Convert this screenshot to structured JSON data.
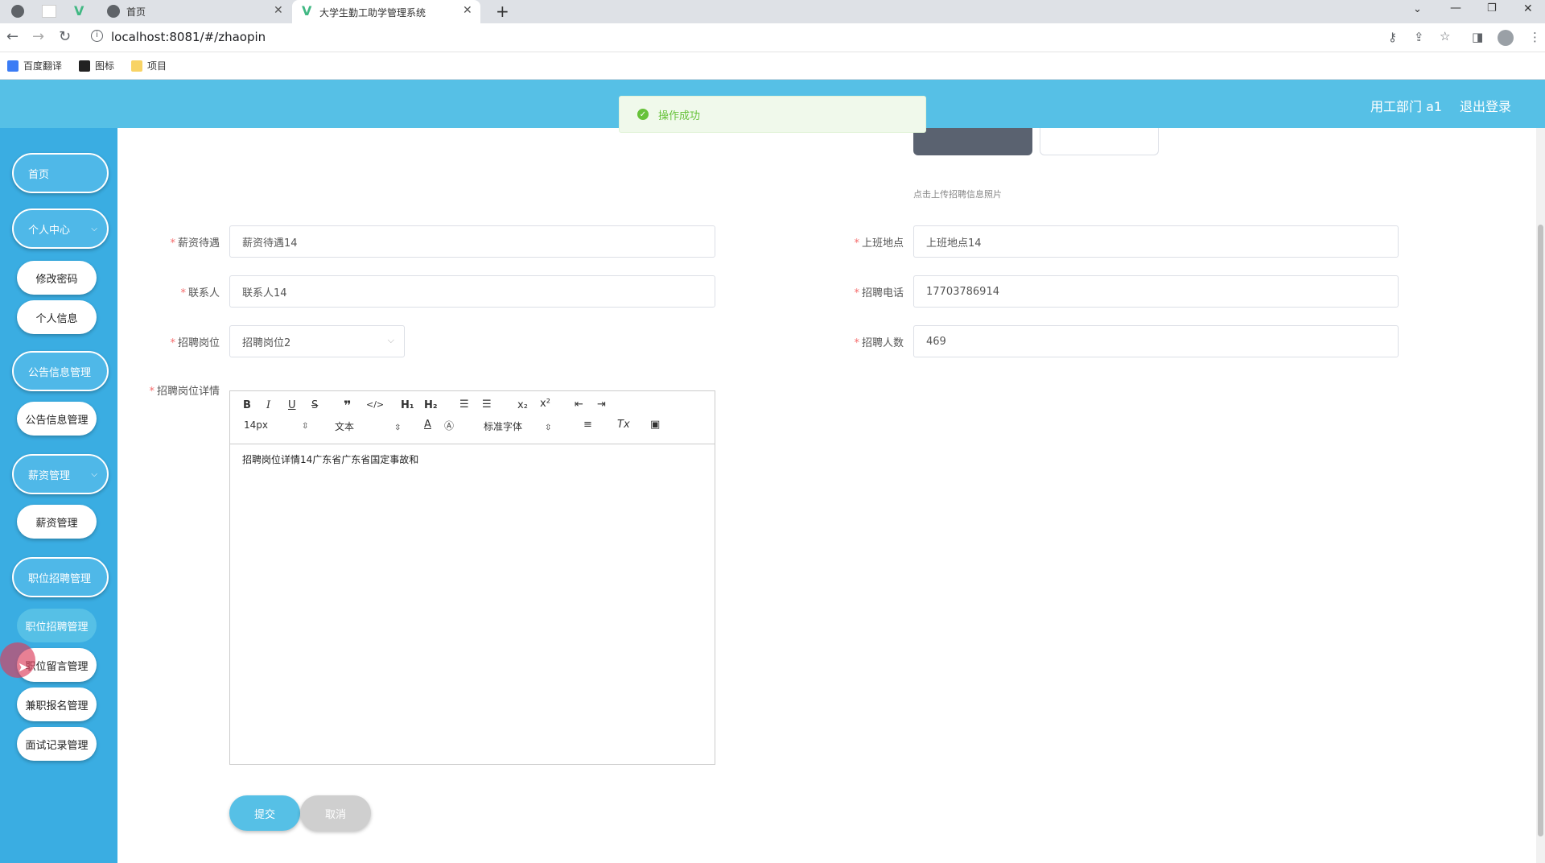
{
  "browser": {
    "tabs": [
      {
        "label": ""
      },
      {
        "label": "首页"
      },
      {
        "label": "大学生勤工助学管理系统"
      }
    ],
    "url": "localhost:8081/#/zhaopin",
    "bookmarks": [
      "百度翻译",
      "图标",
      "项目"
    ]
  },
  "header": {
    "user_label": "用工部门 a1",
    "logout_label": "退出登录"
  },
  "toast": {
    "message": "操作成功"
  },
  "sidebar": {
    "home": "首页",
    "personal_center": "个人中心",
    "change_password": "修改密码",
    "personal_info": "个人信息",
    "notice_group": "公告信息管理",
    "notice_manage": "公告信息管理",
    "salary_group": "薪资管理",
    "salary_manage": "薪资管理",
    "recruit_group": "职位招聘管理",
    "recruit_manage": "职位招聘管理",
    "message_manage": "职位留言管理",
    "apply_manage": "兼职报名管理",
    "interview_manage": "面试记录管理"
  },
  "form": {
    "upload_hint": "点击上传招聘信息照片",
    "salary": {
      "label": "薪资待遇",
      "value": "薪资待遇14"
    },
    "location": {
      "label": "上班地点",
      "value": "上班地点14"
    },
    "contact": {
      "label": "联系人",
      "value": "联系人14"
    },
    "phone": {
      "label": "招聘电话",
      "value": "17703786914"
    },
    "position": {
      "label": "招聘岗位",
      "value": "招聘岗位2"
    },
    "headcount": {
      "label": "招聘人数",
      "value": "469"
    },
    "details": {
      "label": "招聘岗位详情",
      "value": "招聘岗位详情14广东省广东省国定事故和"
    },
    "editor_toolbar": {
      "font_size": "14px",
      "block_type": "文本",
      "font_family": "标准字体"
    },
    "submit_label": "提交",
    "cancel_label": "取消"
  },
  "colors": {
    "header": "#56c0e6",
    "sidebar": "#3aade2",
    "success": "#67c23a",
    "required": "#f56c6c"
  }
}
